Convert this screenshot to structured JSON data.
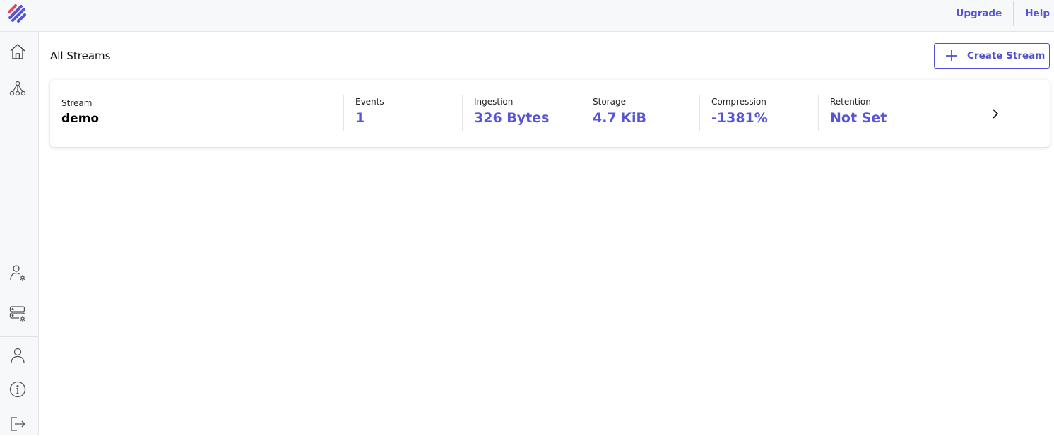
{
  "header": {
    "upgrade_label": "Upgrade",
    "help_label": "Help"
  },
  "sidebar": {
    "items": [
      {
        "icon": "home-icon"
      },
      {
        "icon": "streams-graph-icon"
      },
      {
        "icon": "user-settings-icon"
      },
      {
        "icon": "server-settings-icon"
      },
      {
        "icon": "user-icon"
      },
      {
        "icon": "info-icon"
      },
      {
        "icon": "logout-icon"
      }
    ]
  },
  "main": {
    "title": "All Streams",
    "create_button_label": "Create Stream"
  },
  "stream_card": {
    "stream_label": "Stream",
    "stream_name": "demo",
    "stats": [
      {
        "label": "Events",
        "value": "1"
      },
      {
        "label": "Ingestion",
        "value": "326 Bytes"
      },
      {
        "label": "Storage",
        "value": "4.7 KiB"
      },
      {
        "label": "Compression",
        "value": "-1381%"
      },
      {
        "label": "Retention",
        "value": "Not Set"
      }
    ]
  },
  "colors": {
    "accent": "#5755d6",
    "sidebar_bg": "#f7f8fa",
    "logo_red": "#e8455f",
    "logo_blue": "#5755d6"
  }
}
